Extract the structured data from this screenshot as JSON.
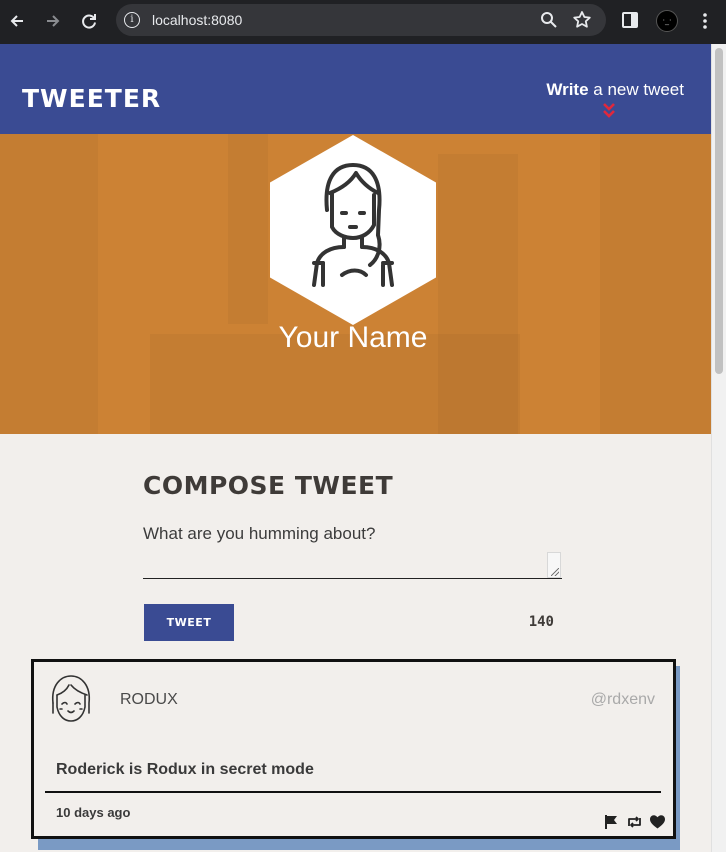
{
  "browser": {
    "url": "localhost:8080",
    "icons": {
      "back": "arrow-left-icon",
      "forward": "arrow-right-icon",
      "reload": "reload-icon",
      "site_info": "info-icon",
      "zoom": "magnifier-icon",
      "bookmark": "star-icon",
      "side_panel": "side-panel-icon",
      "profile": "profile-avatar",
      "menu": "kebab-menu-icon"
    }
  },
  "header": {
    "logo": "TWEETER",
    "write_link_bold": "Write",
    "write_link_rest": " a new tweet",
    "colors": {
      "bar": "#3a4b93",
      "chevron": "#e0283c"
    }
  },
  "hero": {
    "name": "Your Name",
    "colors": {
      "background": "#cc8234"
    }
  },
  "compose": {
    "title": "Compose Tweet",
    "placeholder": "What are you humming about?",
    "value": "",
    "button_label": "Tweet",
    "char_count": "140"
  },
  "tweets": [
    {
      "author": "RODUX",
      "handle": "@rdxenv",
      "content": "Roderick is Rodux in secret mode",
      "time": "10 days ago",
      "actions": [
        "flag-icon",
        "retweet-icon",
        "heart-icon"
      ]
    }
  ]
}
